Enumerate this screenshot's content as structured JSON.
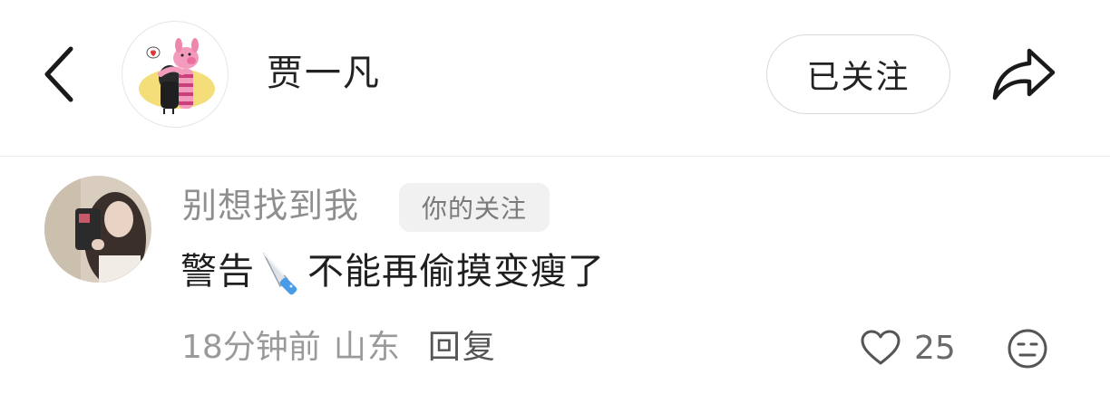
{
  "header": {
    "username": "贾一凡",
    "follow_label": "已关注"
  },
  "comment": {
    "author": "别想找到我",
    "tag": "你的关注",
    "text_before": "警告",
    "text_after": "不能再偷摸变瘦了",
    "time": "18分钟前",
    "location": "山东",
    "reply_label": "回复",
    "like_count": "25"
  },
  "icons": {
    "back": "chevron-left-icon",
    "share": "share-arrow-icon",
    "knife": "knife-emoji",
    "heart": "heart-outline-icon",
    "dislike": "meh-face-icon"
  },
  "colors": {
    "text_primary": "#222222",
    "text_secondary": "#9a9a9a",
    "tag_bg": "#f1f1f1"
  }
}
